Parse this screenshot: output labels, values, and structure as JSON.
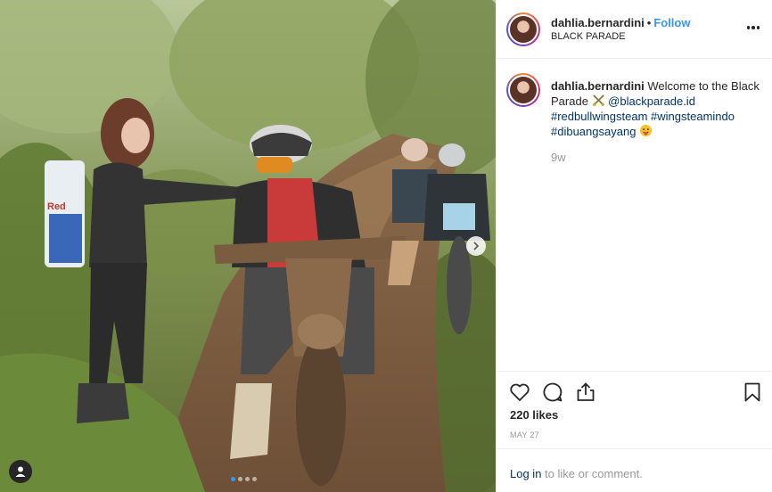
{
  "post": {
    "username": "dahlia.bernardini",
    "separator": "•",
    "follow_label": "Follow",
    "location": "BLACK PARADE",
    "more_icon": "more-options-icon"
  },
  "caption": {
    "username": "dahlia.bernardini",
    "text_1": " Welcome to the Black Parade ",
    "mention": "@blackparade.id",
    "hashtags": [
      "#redbullwingsteam",
      "#wingsteamindo",
      "#dibuangsayang"
    ],
    "time_ago": "9w"
  },
  "actions": {
    "like_icon": "heart-icon",
    "comment_icon": "comment-icon",
    "share_icon": "share-icon",
    "save_icon": "bookmark-icon"
  },
  "stats": {
    "likes": "220 likes",
    "date": "MAY 27"
  },
  "footer": {
    "login_label": "Log in",
    "rest": " to like or comment."
  },
  "carousel": {
    "slide_count": 4,
    "active_index": 0
  },
  "colors": {
    "link": "#3897f0",
    "mention": "#003569",
    "muted": "#999999"
  }
}
